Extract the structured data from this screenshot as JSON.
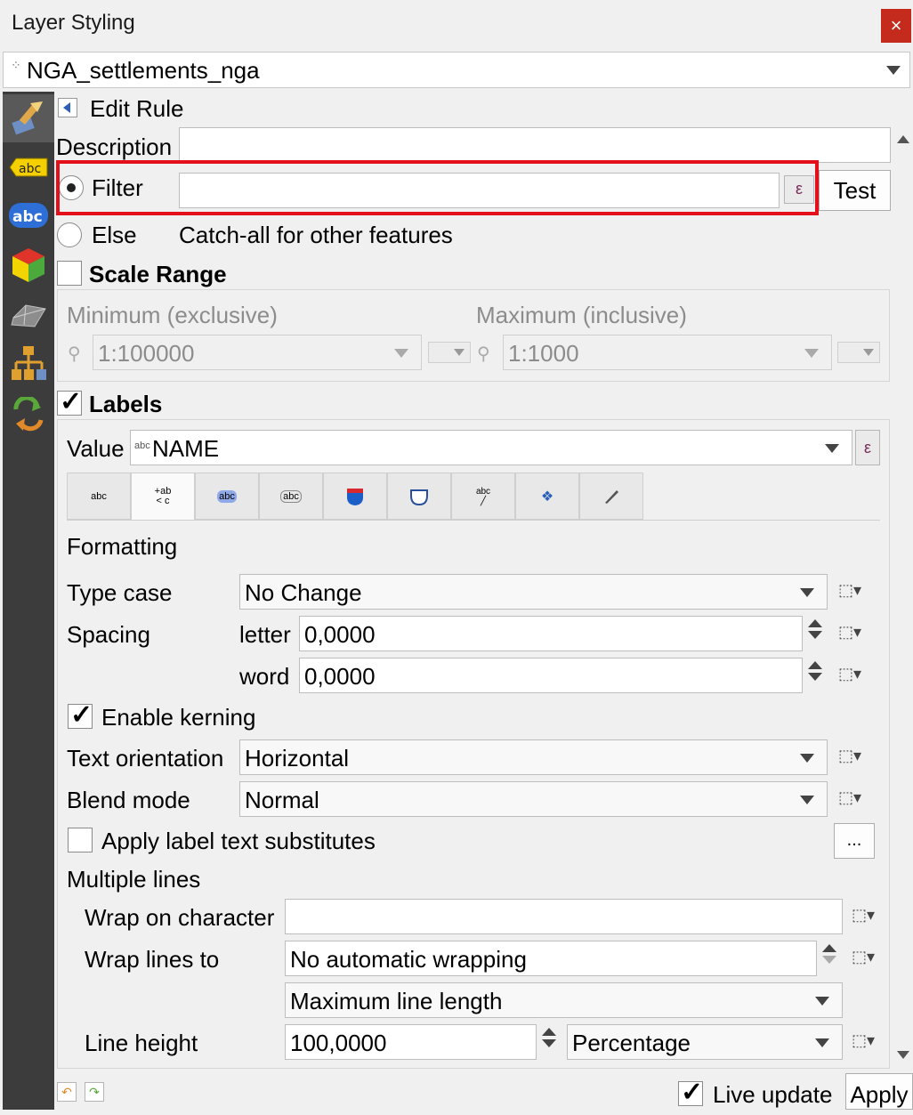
{
  "window": {
    "title": "Layer Styling",
    "close_symbol": "×"
  },
  "layer": {
    "name": "NGA_settlements_nga"
  },
  "sidebar": {
    "icons": [
      "paintbrush-icon",
      "single-label-icon",
      "labels-icon",
      "3d-view-icon",
      "mesh-icon",
      "diagram-icon",
      "history-icon"
    ]
  },
  "rule": {
    "header": "Edit Rule",
    "description_label": "Description",
    "description_value": "",
    "filter_label": "Filter",
    "filter_value": "",
    "epsilon": "ε",
    "test_label": "Test",
    "else_label": "Else",
    "else_desc": "Catch-all for other features"
  },
  "scale_range": {
    "label": "Scale Range",
    "checked": false,
    "min_label": "Minimum (exclusive)",
    "max_label": "Maximum (inclusive)",
    "min_value": "1:100000",
    "max_value": "1:1000"
  },
  "labels": {
    "label": "Labels",
    "checked": true,
    "value_label": "Value",
    "value_field": "NAME",
    "value_prefix": "abc",
    "tabs": [
      "text",
      "formatting",
      "buffer",
      "mask",
      "background",
      "shadow",
      "callouts",
      "placement",
      "rendering"
    ]
  },
  "formatting": {
    "section": "Formatting",
    "type_case_label": "Type case",
    "type_case_value": "No Change",
    "spacing_label": "Spacing",
    "letter_label": "letter",
    "letter_value": "0,0000",
    "word_label": "word",
    "word_value": "0,0000",
    "kerning_label": "Enable kerning",
    "kerning_checked": true,
    "orientation_label": "Text orientation",
    "orientation_value": "Horizontal",
    "blend_label": "Blend mode",
    "blend_value": "Normal",
    "substitutes_label": "Apply label text substitutes",
    "substitutes_checked": false,
    "ellipsis": "..."
  },
  "multiple_lines": {
    "section": "Multiple lines",
    "wrap_char_label": "Wrap on character",
    "wrap_char_value": "",
    "wrap_lines_label": "Wrap lines to",
    "wrap_lines_value": "No automatic wrapping",
    "wrap_mode_value": "Maximum line length",
    "line_height_label": "Line height",
    "line_height_value": "100,0000",
    "line_height_unit": "Percentage"
  },
  "footer": {
    "live_update_label": "Live update",
    "live_update_checked": true,
    "apply_label": "Apply"
  }
}
